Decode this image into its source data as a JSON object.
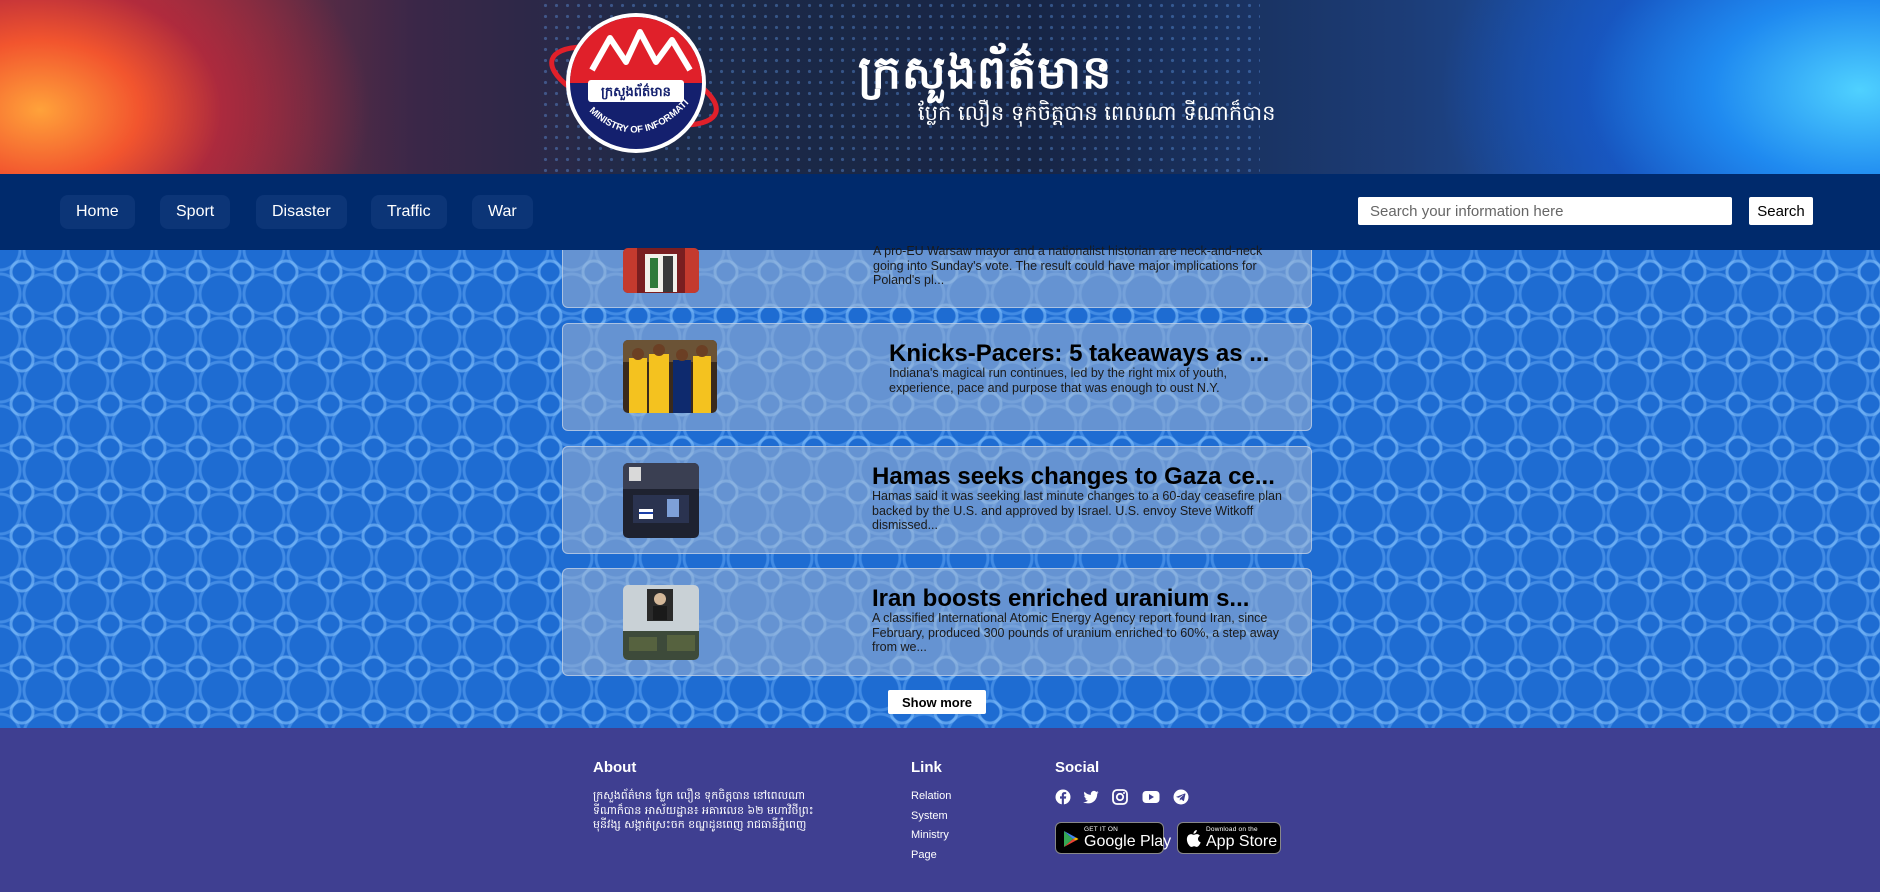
{
  "header": {
    "logo_text_kh": "ក្រសួងព័ត៌មាន",
    "logo_text_en": "MINISTRY OF INFORMATION",
    "site_title": "ក្រសួងព័ត៌មាន",
    "slogan": "ប្លែក លឿន ទុកចិត្តបាន ពេលណា ទីណាក៏បាន",
    "colors": {
      "banner_left": "#f2552e",
      "banner_right": "#1f8af0",
      "navbar": "#002a6c"
    }
  },
  "nav": {
    "items": [
      {
        "label": "Home"
      },
      {
        "label": "Sport"
      },
      {
        "label": "Disaster"
      },
      {
        "label": "Traffic"
      },
      {
        "label": "War"
      }
    ],
    "search": {
      "placeholder": "Search your information here",
      "value": "",
      "button_label": "Search"
    }
  },
  "articles": [
    {
      "title": "",
      "summary": "A pro-EU Warsaw mayor and a nationalist historian are neck-and-neck going into Sunday's vote. The result could have major implications for Poland's pl...",
      "thumbnail_icon": "election-podium-image"
    },
    {
      "title": "Knicks-Pacers: 5 takeaways as ...",
      "summary": "Indiana's magical run continues, led by the right mix of youth, experience, pace and purpose that was enough to oust N.Y.",
      "thumbnail_icon": "basketball-players-image"
    },
    {
      "title": "Hamas seeks changes to Gaza ce...",
      "summary": "Hamas said it was seeking last minute changes to a 60-day ceasefire plan backed by the U.S. and approved by Israel. U.S. envoy Steve Witkoff dismissed...",
      "thumbnail_icon": "press-conference-image"
    },
    {
      "title": "Iran boosts enriched uranium s...",
      "summary": "A classified International Atomic Energy Agency report found Iran, since February, produced 300 pounds of uranium enriched to 60%, a step away from we...",
      "thumbnail_icon": "military-parade-image"
    }
  ],
  "main": {
    "show_more_label": "Show more"
  },
  "footer": {
    "about": {
      "heading": "About",
      "text": "ក្រសួងព័ត៌មាន ប្លែក លឿន ទុកចិត្តបាន នៅពេលណា ទីណាក៏បាន អាស័យដ្ឋាន៖ អគារលេខ ៦២ មហាវិថីព្រះមុនីវង្ស សង្កាត់ស្រះចក ខណ្ឌដូនពេញ រាជធានីភ្នំពេញ"
    },
    "links": {
      "heading": "Link",
      "items": [
        {
          "label": "Relation"
        },
        {
          "label": "System"
        },
        {
          "label": "Ministry"
        },
        {
          "label": "Page"
        }
      ]
    },
    "social": {
      "heading": "Social",
      "icons": [
        "facebook-icon",
        "twitter-icon",
        "instagram-icon",
        "youtube-icon",
        "telegram-icon"
      ],
      "google_play": {
        "small": "GET IT ON",
        "big": "Google Play"
      },
      "app_store": {
        "small": "Download on the",
        "big": "App Store"
      }
    },
    "colors": {
      "background": "#3f3f91"
    }
  }
}
